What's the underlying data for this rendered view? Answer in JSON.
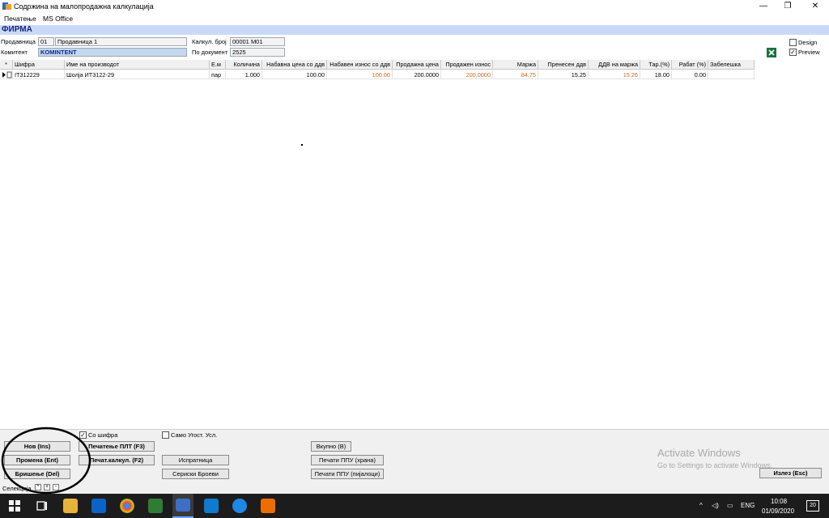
{
  "window": {
    "title": "Содржина на малопродажна калкулација",
    "minimize": "—",
    "restore": "❐",
    "close": "✕"
  },
  "menu": [
    "Печатење",
    "MS Office"
  ],
  "firma": "ФИРМА",
  "header": {
    "prodavnica_label": "Продавница",
    "prodavnica_code": "01",
    "prodavnica_name": "Продавница 1",
    "komitent_label": "Комитент",
    "komitent_value": "KOMINTENT",
    "kalk_label": "Калкул. број",
    "kalk_value": "00001  M01",
    "dokument_label": "По документ",
    "dokument_value": "2525"
  },
  "options": {
    "design_label": "Design",
    "design_checked": false,
    "preview_label": "Preview",
    "preview_checked": true
  },
  "grid": {
    "columns": [
      "*",
      "Шифра",
      "Име на производот",
      "Е.м",
      "Количина",
      "Набавна цена со ддв",
      "Набавен износ со ддв",
      "Продажна цена",
      "Продажен износ",
      "Маржа",
      "Пренесен ддв",
      "ДДВ на маржа",
      "Тар.(%)",
      "Рабат (%)",
      "Забелешка"
    ],
    "rows": [
      {
        "sifra": "IT312229",
        "ime": "Шолја ИТ3122-29",
        "em": "пар",
        "kolicina": "1.000",
        "nabavna_cena": "100.00",
        "nabaven_iznos": "100.00",
        "prodazna_cena": "200.0000",
        "prodazen_iznos": "200.0000",
        "marza": "84.75",
        "prenesen_ddv": "15.25",
        "ddv_marza": "15.26",
        "tar": "18.00",
        "rabat": "0.00",
        "zabeleska": ""
      }
    ]
  },
  "bottom": {
    "so_sifra_label": "Со шифра",
    "so_sifra_checked": true,
    "samo_ugost_label": "Само Угост. Усл.",
    "samo_ugost_checked": false,
    "nov": "Нов (Ins)",
    "promena": "Промена (Ent)",
    "brisenje": "Бришење (Del)",
    "pecatenje_plt": "Печатење ПЛТ (F3)",
    "pecat_kalkul": "Печат.калкул. (F2)",
    "ispratnica": "Испратница",
    "seriski": "Сериски Броеви",
    "vkupno": "Вкупно (B)",
    "pecati_ppu_hrana": "Печати ППУ (храна)",
    "pecati_ppu_pijaloci": "Печати ППУ (пијалоци)",
    "izlez": "Излез (Esc)",
    "selekcija_label": "Селекција"
  },
  "activate_windows": {
    "title": "Activate Windows",
    "subtitle": "Go to Settings to activate Windows."
  },
  "taskbar": {
    "lang": "ENG",
    "time": "10:08",
    "date": "01/09/2020",
    "notifications": "20"
  }
}
